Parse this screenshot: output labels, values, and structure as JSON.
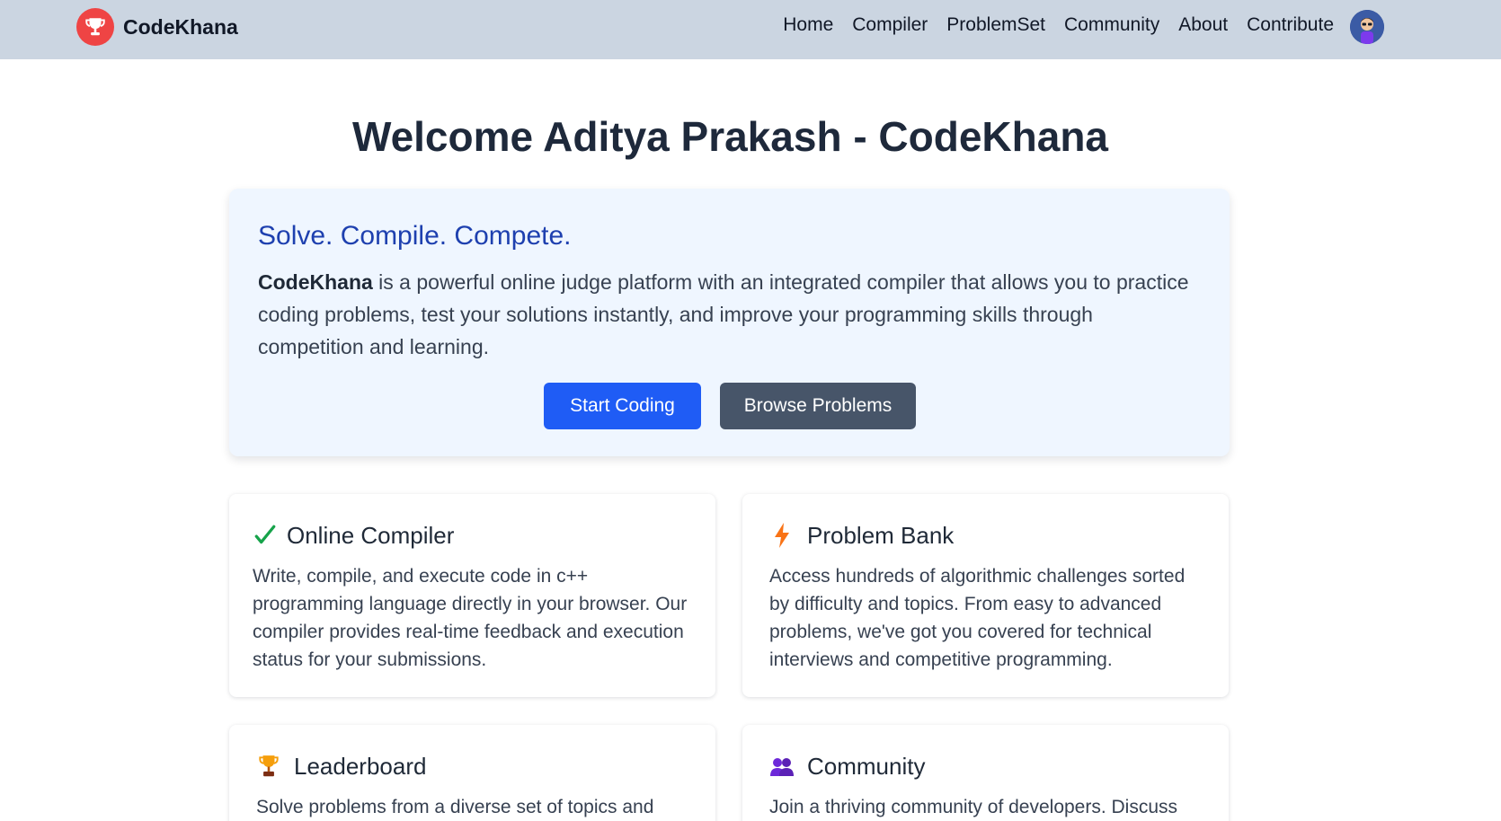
{
  "brand": {
    "name": "CodeKhana",
    "logo_icon": "trophy-icon",
    "logo_color": "#ef4444"
  },
  "nav": {
    "links": [
      "Home",
      "Compiler",
      "ProblemSet",
      "Community",
      "About",
      "Contribute"
    ],
    "avatar_icon": "user-avatar-icon"
  },
  "welcome": {
    "title": "Welcome Aditya Prakash - CodeKhana"
  },
  "hero": {
    "title": "Solve. Compile. Compete.",
    "desc_bold": "CodeKhana",
    "desc_rest": " is a powerful online judge platform with an integrated compiler that allows you to practice coding problems, test your solutions instantly, and improve your programming skills through competition and learning.",
    "primary_button": "Start Coding",
    "secondary_button": "Browse Problems"
  },
  "features": [
    {
      "icon": "checkmark-icon",
      "title": "Online Compiler",
      "text": "Write, compile, and execute code in c++ programming language directly in your browser. Our compiler provides real-time feedback and execution status for your submissions."
    },
    {
      "icon": "lightning-icon",
      "title": "Problem Bank",
      "text": "Access hundreds of algorithmic challenges sorted by difficulty and topics. From easy to advanced problems, we've got you covered for technical interviews and competitive programming."
    },
    {
      "icon": "trophy-icon",
      "title": "Leaderboard",
      "text": "Solve problems from a diverse set of topics and earn"
    },
    {
      "icon": "people-icon",
      "title": "Community",
      "text": "Join a thriving community of developers. Discuss"
    }
  ],
  "colors": {
    "navbar": "#cbd5e1",
    "hero_bg": "#eff6ff",
    "primary": "#1f5cf5",
    "secondary": "#475569",
    "hero_title": "#1e40af"
  }
}
